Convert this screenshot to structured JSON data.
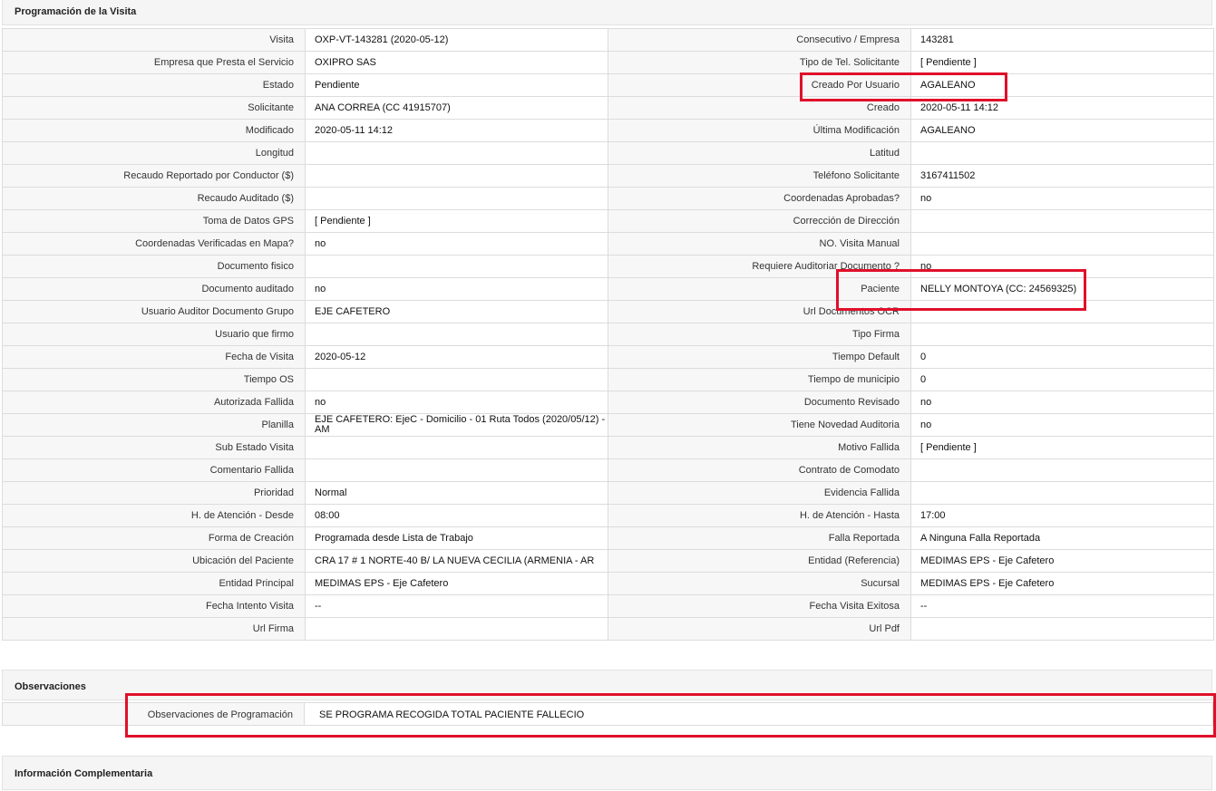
{
  "sections": {
    "programacion": "Programación de la Visita",
    "observaciones": "Observaciones",
    "complementaria": "Información Complementaria"
  },
  "rows": [
    {
      "l1": "Visita",
      "v1": "OXP-VT-143281 (2020-05-12)",
      "l2": "Consecutivo / Empresa",
      "v2": "143281"
    },
    {
      "l1": "Empresa que Presta el Servicio",
      "v1": "OXIPRO SAS",
      "l2": "Tipo de Tel. Solicitante",
      "v2": "[ Pendiente ]"
    },
    {
      "l1": "Estado",
      "v1": "Pendiente",
      "l2": "Creado Por Usuario",
      "v2": "AGALEANO"
    },
    {
      "l1": "Solicitante",
      "v1": "ANA CORREA (CC 41915707)",
      "l2": "Creado",
      "v2": "2020-05-11 14:12"
    },
    {
      "l1": "Modificado",
      "v1": "2020-05-11 14:12",
      "l2": "Última Modificación",
      "v2": " AGALEANO"
    },
    {
      "l1": "Longitud",
      "v1": "",
      "l2": "Latitud",
      "v2": ""
    },
    {
      "l1": "Recaudo Reportado por Conductor ($)",
      "v1": "",
      "l2": "Teléfono Solicitante",
      "v2": "3167411502"
    },
    {
      "l1": "Recaudo Auditado ($)",
      "v1": "",
      "l2": "Coordenadas Aprobadas?",
      "v2": " no"
    },
    {
      "l1": "Toma de Datos GPS",
      "v1": "[ Pendiente ]",
      "l2": "Corrección de Dirección",
      "v2": ""
    },
    {
      "l1": "Coordenadas Verificadas en Mapa?",
      "v1": " no",
      "l2": "NO. Visita Manual",
      "v2": ""
    },
    {
      "l1": "Documento fisico",
      "v1": "",
      "l2": "Requiere Auditoriar Documento ?",
      "v2": " no"
    },
    {
      "l1": "Documento auditado",
      "v1": " no",
      "l2": "Paciente",
      "v2": "NELLY MONTOYA (CC: 24569325)"
    },
    {
      "l1": "Usuario Auditor Documento Grupo",
      "v1": "EJE CAFETERO",
      "l2": "Url Documentos OCR",
      "v2": ""
    },
    {
      "l1": "Usuario que firmo",
      "v1": "",
      "l2": "Tipo Firma",
      "v2": ""
    },
    {
      "l1": "Fecha de Visita",
      "v1": " 2020-05-12",
      "l2": "Tiempo Default",
      "v2": " 0"
    },
    {
      "l1": "Tiempo OS",
      "v1": "",
      "l2": "Tiempo de municipio",
      "v2": " 0"
    },
    {
      "l1": "Autorizada Fallida",
      "v1": " no",
      "l2": "Documento Revisado",
      "v2": " no"
    },
    {
      "l1": "Planilla",
      "v1": "EJE CAFETERO: EjeC - Domicilio - 01 Ruta Todos (2020/05/12) - AM",
      "l2": "Tiene Novedad Auditoria",
      "v2": " no"
    },
    {
      "l1": "Sub Estado Visita",
      "v1": "",
      "l2": "Motivo Fallida",
      "v2": "[ Pendiente ]"
    },
    {
      "l1": "Comentario Fallida",
      "v1": "",
      "l2": "Contrato de Comodato",
      "v2": ""
    },
    {
      "l1": "Prioridad",
      "v1": "Normal",
      "l2": "Evidencia Fallida",
      "v2": ""
    },
    {
      "l1": "H. de Atención - Desde",
      "v1": "08:00",
      "l2": "H. de Atención - Hasta",
      "v2": "17:00"
    },
    {
      "l1": "Forma de Creación",
      "v1": "Programada desde Lista de Trabajo",
      "l2": "Falla Reportada",
      "v2": "A Ninguna Falla Reportada"
    },
    {
      "l1": "Ubicación del Paciente",
      "v1": "CRA 17 # 1 NORTE-40 B/ LA NUEVA CECILIA (ARMENIA - AR",
      "l2": "Entidad (Referencia)",
      "v2": "MEDIMAS EPS - Eje Cafetero"
    },
    {
      "l1": "Entidad Principal",
      "v1": "MEDIMAS EPS - Eje Cafetero",
      "l2": "Sucursal",
      "v2": "MEDIMAS EPS - Eje Cafetero"
    },
    {
      "l1": "Fecha Intento Visita",
      "v1": " --",
      "l2": "Fecha Visita Exitosa",
      "v2": " --"
    },
    {
      "l1": "Url Firma",
      "v1": "",
      "l2": "Url Pdf",
      "v2": ""
    }
  ],
  "observaciones": {
    "label": "Observaciones de Programación",
    "value": "SE PROGRAMA RECOGIDA TOTAL PACIENTE FALLECIO"
  },
  "highlight_color": "#e0102a"
}
